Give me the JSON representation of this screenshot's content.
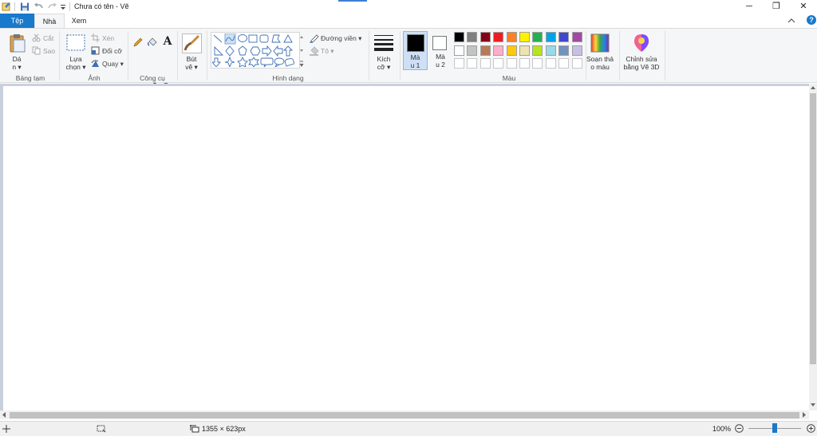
{
  "window": {
    "title": "Chưa có tên - Vẽ",
    "minimize_icon": "─",
    "maximize_icon": "❐",
    "close_icon": "✕"
  },
  "tabs": [
    {
      "label": "Tệp"
    },
    {
      "label": "Nhà"
    },
    {
      "label": "Xem"
    }
  ],
  "clipboard": {
    "paste_label_1": "Dá",
    "paste_label_2": "n ▾",
    "cut_label": "Cắt",
    "copy_label": "Sao",
    "group_label": "Bảng tạm"
  },
  "image": {
    "select_label_1": "Lựa",
    "select_label_2": "chọn ▾",
    "crop_label": "Xén",
    "resize_label": "Đổi cỡ",
    "rotate_label": "Quay ▾",
    "group_label": "Ảnh"
  },
  "tools": {
    "text_glyph": "A",
    "group_label": "Công cụ"
  },
  "brushes": {
    "label_1": "Bút",
    "label_2": "vẽ ▾"
  },
  "shapes": {
    "outline_label": "Đường viền ▾",
    "fill_label": "Tô ▾",
    "group_label": "Hình dạng"
  },
  "size": {
    "label_1": "Kích",
    "label_2": "cỡ ▾"
  },
  "colors": {
    "color1_label_1": "Mà",
    "color1_label_2": "u 1",
    "color2_label_1": "Mà",
    "color2_label_2": "u 2",
    "edit_colors_label_1": "Soạn thả",
    "edit_colors_label_2": "o màu",
    "group_label": "Màu",
    "color1": "#000000",
    "color2": "#ffffff",
    "palette_row1": [
      "#000000",
      "#7f7f7f",
      "#880015",
      "#ed1c24",
      "#ff7f27",
      "#fff200",
      "#22b14c",
      "#00a2e8",
      "#3f48cc",
      "#a349a4"
    ],
    "palette_row2": [
      "#ffffff",
      "#c3c3c3",
      "#b97a57",
      "#ffaec9",
      "#ffc90e",
      "#efe4b0",
      "#b5e61d",
      "#99d9ea",
      "#7092be",
      "#c8bfe7"
    ],
    "palette_row3": [
      "#ffffff",
      "#ffffff",
      "#ffffff",
      "#ffffff",
      "#ffffff",
      "#ffffff",
      "#ffffff",
      "#ffffff",
      "#ffffff",
      "#ffffff"
    ]
  },
  "paint3d": {
    "label_1": "Chỉnh sửa",
    "label_2": "bằng Vẽ 3D"
  },
  "status": {
    "canvas_size": "1355 × 623px",
    "zoom": "100%",
    "zoom_level": 0.5
  }
}
